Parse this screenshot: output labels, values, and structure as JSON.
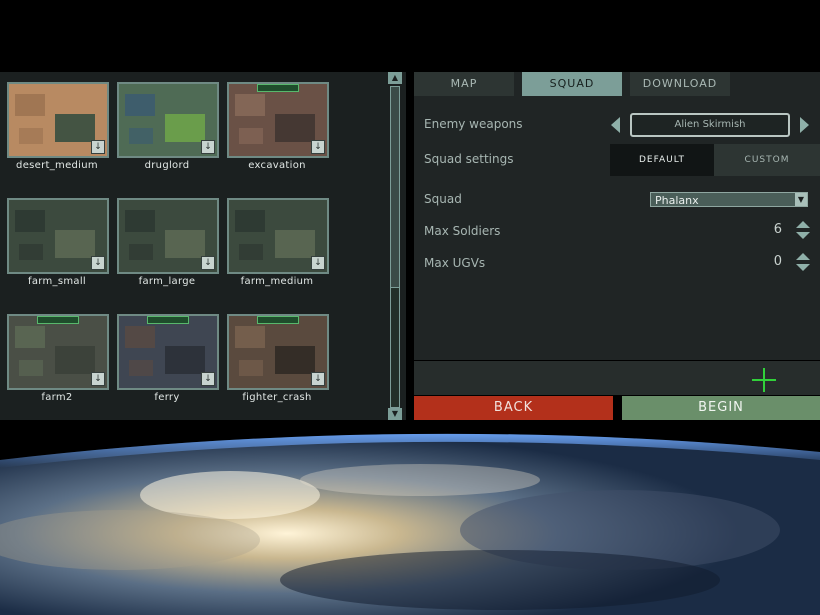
{
  "maps": [
    {
      "name": "desert_medium",
      "invasion": false
    },
    {
      "name": "druglord",
      "invasion": false
    },
    {
      "name": "excavation",
      "invasion": true
    },
    {
      "name": "farm_small",
      "invasion": false
    },
    {
      "name": "farm_large",
      "invasion": false
    },
    {
      "name": "farm_medium",
      "invasion": false
    },
    {
      "name": "farm2",
      "invasion": true
    },
    {
      "name": "ferry",
      "invasion": true
    },
    {
      "name": "fighter_crash",
      "invasion": true
    }
  ],
  "tabs": {
    "map": "MAP",
    "squad": "SQUAD",
    "download": "DOWNLOAD",
    "active": "squad"
  },
  "settings": {
    "enemy_weapons_label": "Enemy weapons",
    "enemy_weapons_value": "Alien Skirmish",
    "squad_settings_label": "Squad settings",
    "default_tab": "DEFAULT",
    "custom_tab": "CUSTOM",
    "squad_label": "Squad",
    "squad_value": "Phalanx",
    "max_soldiers_label": "Max Soldiers",
    "max_soldiers_value": "6",
    "max_ugvs_label": "Max UGVs",
    "max_ugvs_value": "0"
  },
  "buttons": {
    "back": "BACK",
    "begin": "BEGIN"
  },
  "colors": {
    "accent": "#7c9e98",
    "back": "#b3301b",
    "begin": "#6a8f6a",
    "crosshair": "#31d13a"
  }
}
